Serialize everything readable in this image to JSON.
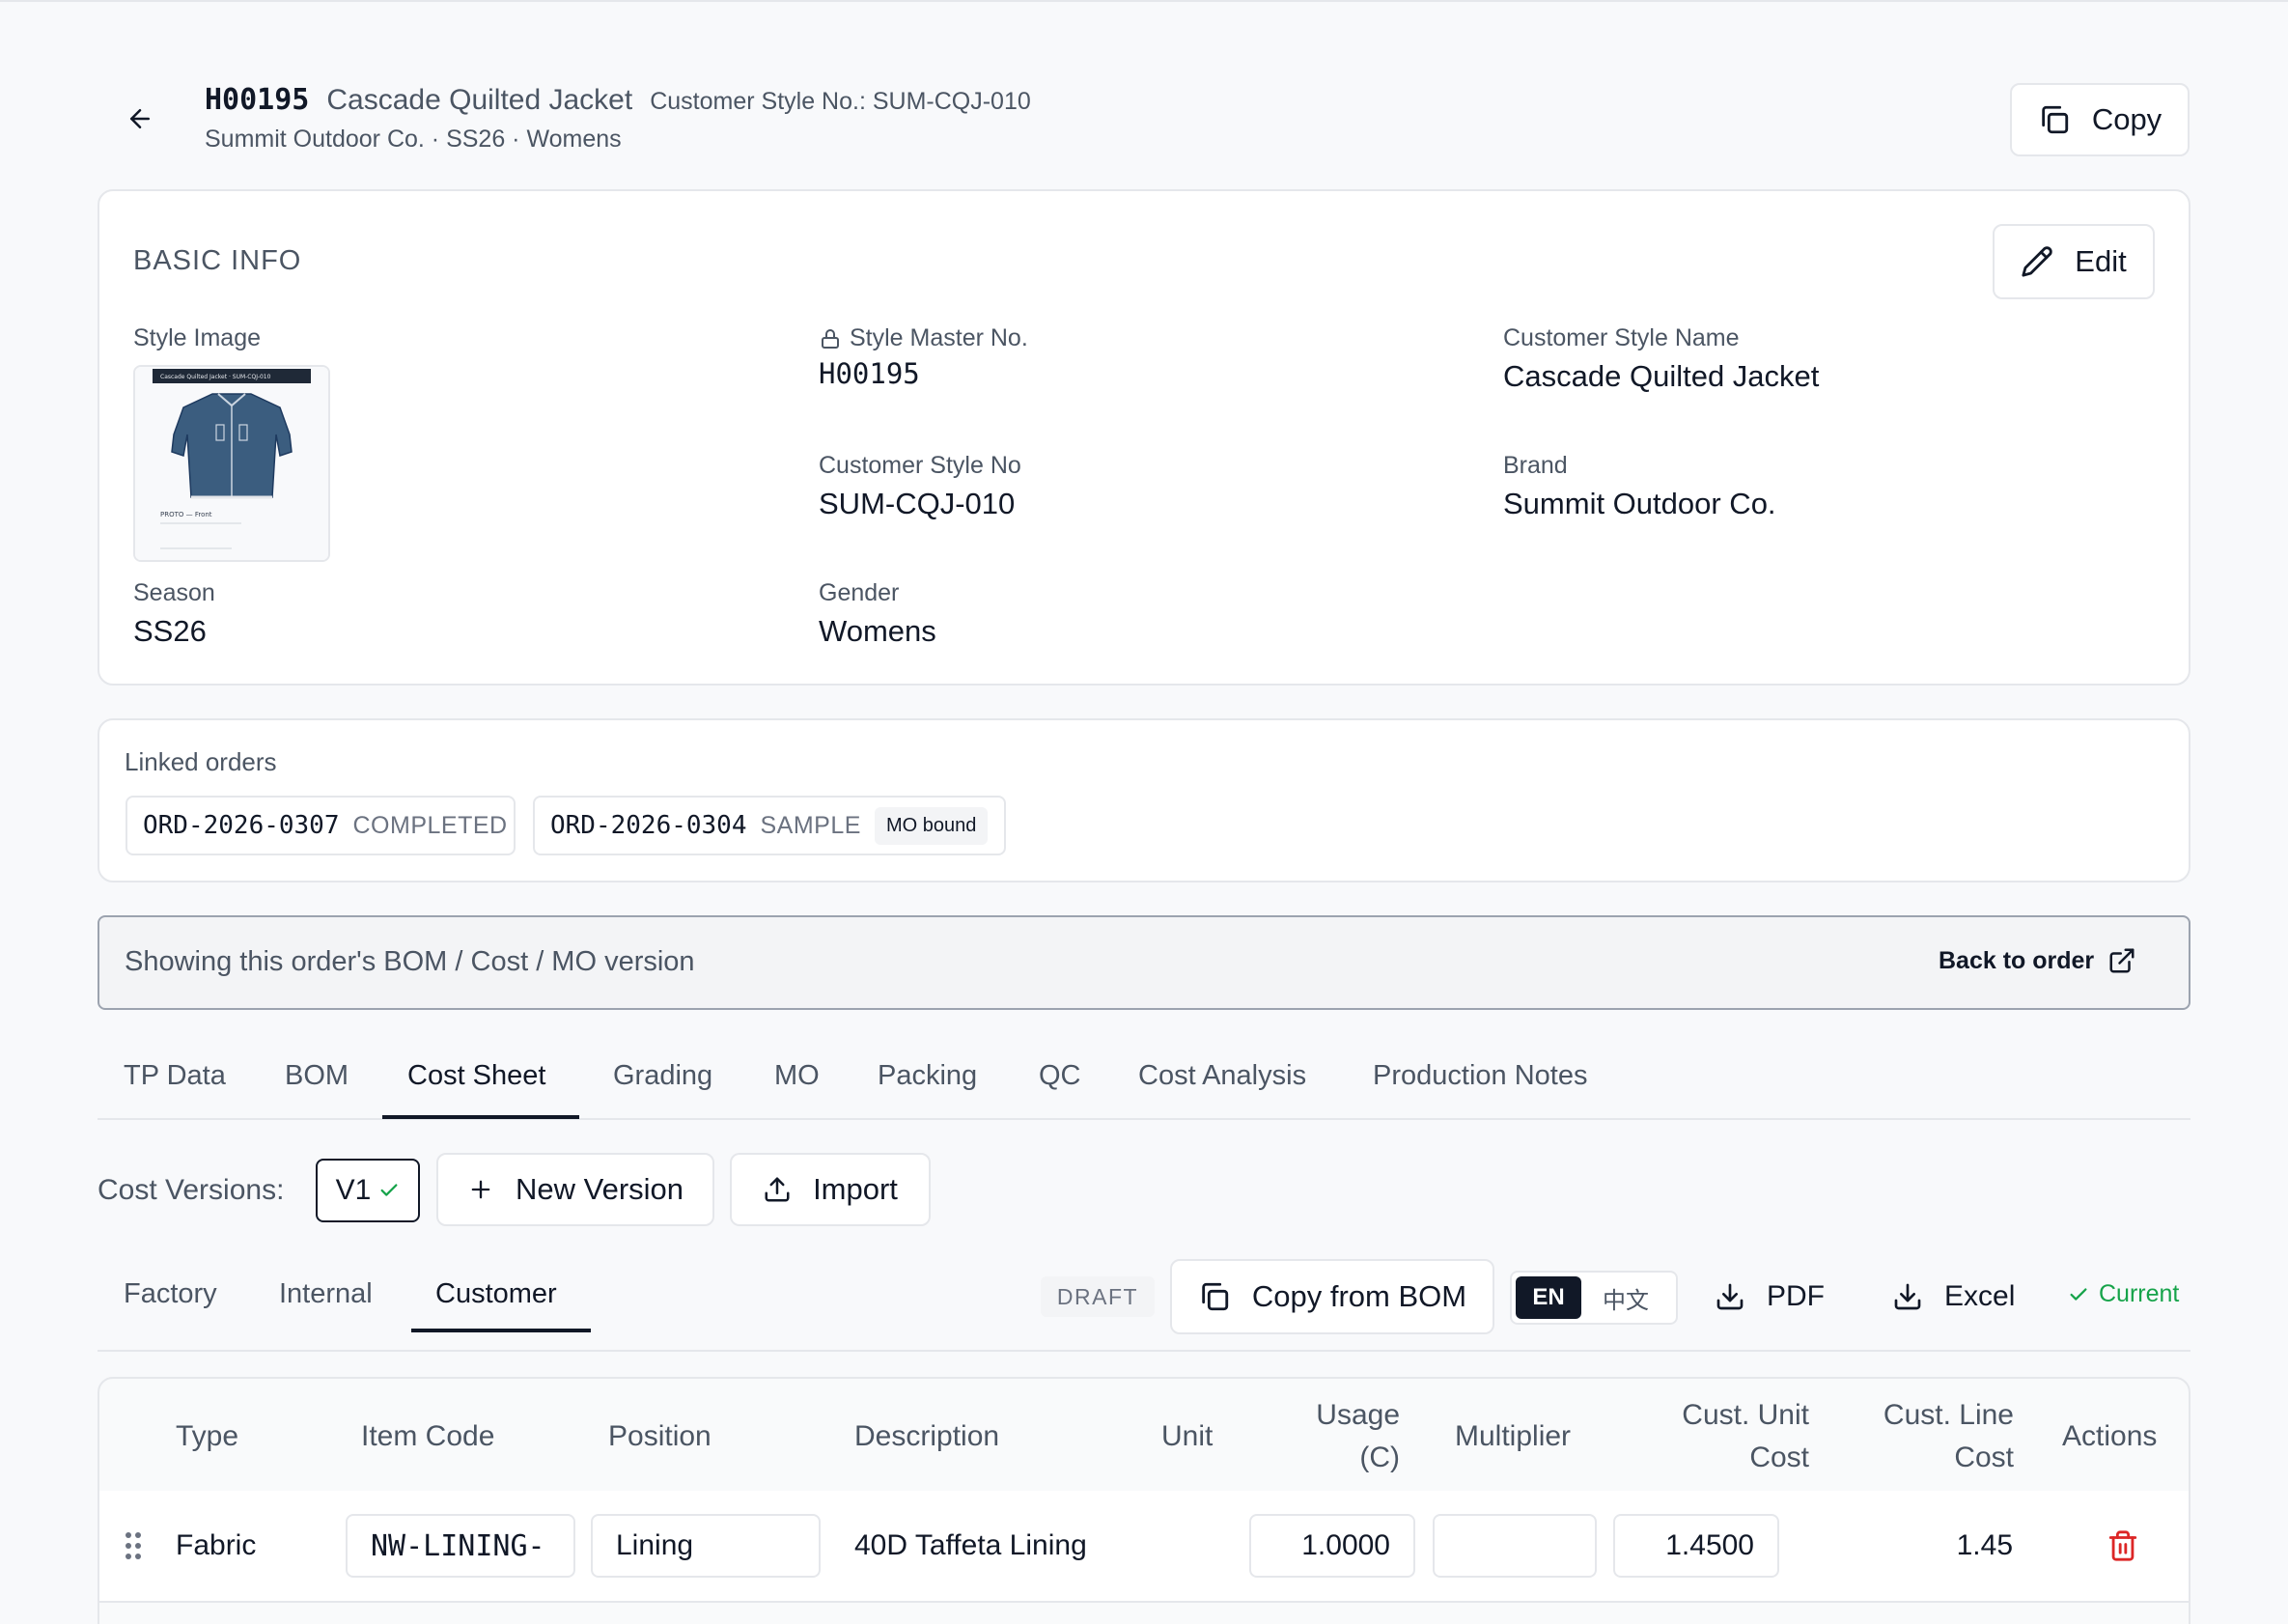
{
  "header": {
    "style_code": "H00195",
    "style_name": "Cascade Quilted Jacket",
    "customer_style_no": "Customer Style No.: SUM-CQJ-010",
    "subtitle": "Summit Outdoor Co. · SS26 · Womens",
    "copy_label": "Copy"
  },
  "basic_info": {
    "title": "BASIC INFO",
    "edit_label": "Edit",
    "style_image_label": "Style Image",
    "thumbnail": {
      "caption_top": "Cascade Quilted Jacket · SUM-CQJ-010",
      "caption_bottom": "PROTO — Front"
    },
    "style_master_no_label": "Style Master No.",
    "style_master_no": "H00195",
    "customer_style_name_label": "Customer Style Name",
    "customer_style_name": "Cascade Quilted Jacket",
    "customer_style_no_label": "Customer Style No",
    "customer_style_no": "SUM-CQJ-010",
    "brand_label": "Brand",
    "brand": "Summit Outdoor Co.",
    "season_label": "Season",
    "season": "SS26",
    "gender_label": "Gender",
    "gender": "Womens"
  },
  "linked_orders": {
    "title": "Linked orders",
    "orders": [
      {
        "code": "ORD-2026-0307",
        "status": "COMPLETED",
        "badge": ""
      },
      {
        "code": "ORD-2026-0304",
        "status": "SAMPLE",
        "badge": "MO bound"
      }
    ]
  },
  "notice": {
    "text": "Showing this order's BOM / Cost / MO version",
    "back_label": "Back to order"
  },
  "tabs": [
    "TP Data",
    "BOM",
    "Cost Sheet",
    "Grading",
    "MO",
    "Packing",
    "QC",
    "Cost Analysis",
    "Production Notes"
  ],
  "active_tab": "Cost Sheet",
  "cost_versions": {
    "label": "Cost Versions:",
    "current": "V1",
    "new_version_label": "New Version",
    "import_label": "Import"
  },
  "subtabs": [
    "Factory",
    "Internal",
    "Customer"
  ],
  "active_subtab": "Customer",
  "toolbar": {
    "status": "DRAFT",
    "copy_from_bom_label": "Copy from BOM",
    "lang_en": "EN",
    "lang_zh": "中文",
    "pdf_label": "PDF",
    "excel_label": "Excel",
    "current_label": "Current"
  },
  "table": {
    "headers": {
      "type": "Type",
      "item_code": "Item Code",
      "position": "Position",
      "description": "Description",
      "unit": "Unit",
      "usage_1": "Usage",
      "usage_2": "(C)",
      "multiplier": "Multiplier",
      "unit_cost_1": "Cust. Unit",
      "unit_cost_2": "Cost",
      "line_cost_1": "Cust. Line",
      "line_cost_2": "Cost",
      "actions": "Actions"
    },
    "rows": [
      {
        "type": "Fabric",
        "item_code": "NW-LINING-",
        "position": "Lining",
        "description": "40D Taffeta Lining",
        "unit": "",
        "usage": "1.0000",
        "multiplier": "",
        "unit_cost": "1.4500",
        "line_cost": "1.45"
      }
    ]
  },
  "colors": {
    "accent": "#111827",
    "success": "#16a34a",
    "danger": "#dc2626",
    "border": "#e5e7eb",
    "jacket": "#3b5d7f"
  },
  "icons": [
    "arrow-left-icon",
    "copy-icon",
    "pencil-icon",
    "lock-icon",
    "external-link-icon",
    "check-icon",
    "plus-icon",
    "upload-icon",
    "download-icon",
    "drag-handle-icon",
    "trash-icon"
  ]
}
